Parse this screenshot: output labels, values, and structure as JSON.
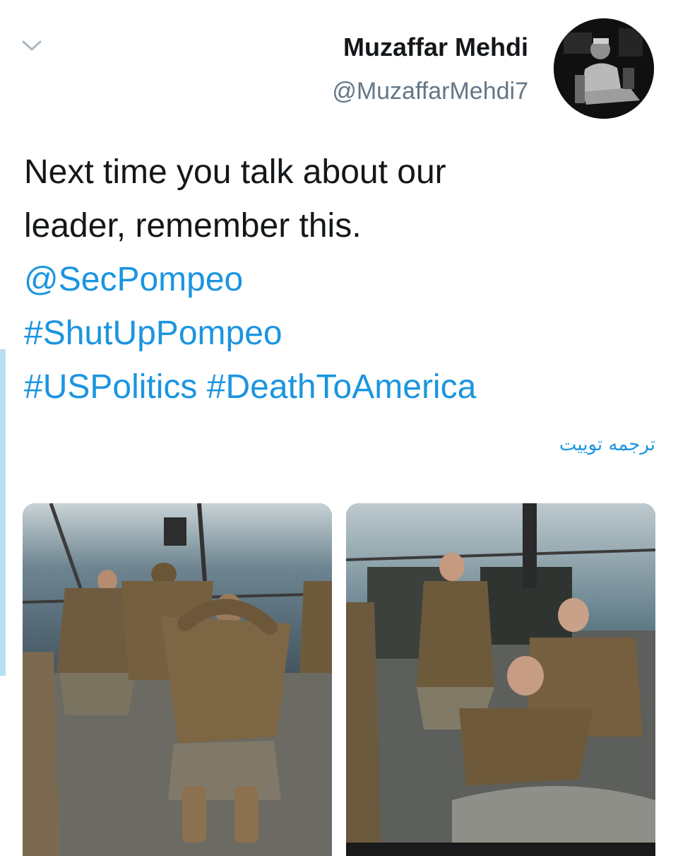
{
  "user": {
    "display_name": "Muzaffar Mehdi",
    "handle": "@MuzaffarMehdi7",
    "avatar_icon": "avatar-portrait"
  },
  "tweet": {
    "text_line1": "Next time you talk about our",
    "text_line2": "leader, remember this.",
    "mention": "@SecPompeo",
    "hashtag1": "#ShutUpPompeo",
    "hashtag2": "#USPolitics",
    "hashtag3": "#DeathToAmerica"
  },
  "translate_label": "ترجمه توییت",
  "media": {
    "count": 2,
    "icons": [
      "photo-sailors-kneeling-back",
      "photo-sailors-kneeling-front"
    ]
  },
  "colors": {
    "text": "#14171a",
    "secondary": "#657786",
    "link": "#1b95e0",
    "background": "#ffffff"
  },
  "icons": {
    "menu": "chevron-down-icon"
  }
}
